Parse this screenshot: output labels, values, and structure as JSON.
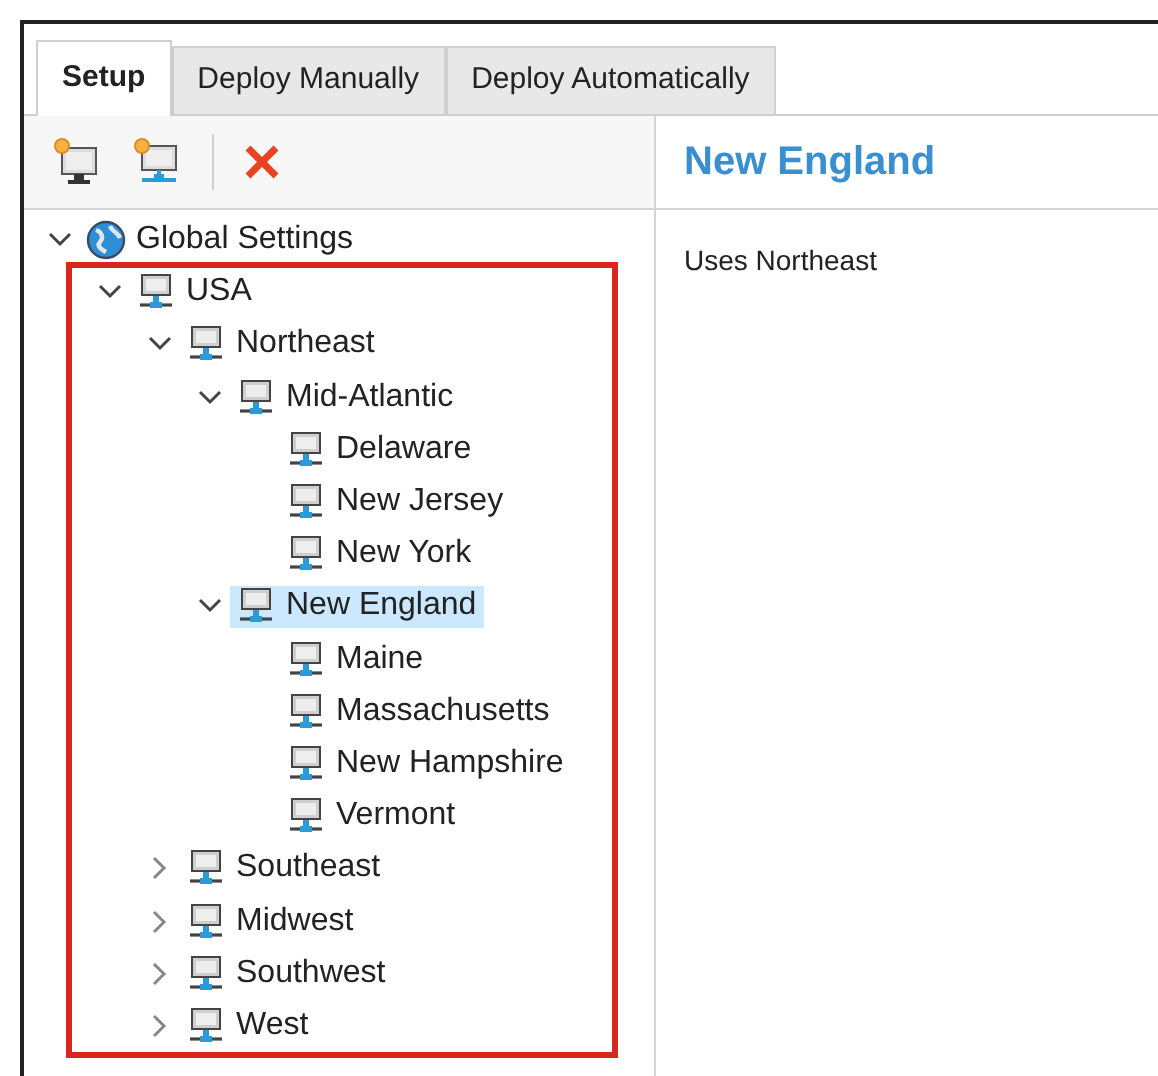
{
  "tabs": [
    {
      "label": "Setup",
      "selected": true
    },
    {
      "label": "Deploy Manually",
      "selected": false
    },
    {
      "label": "Deploy Automatically",
      "selected": false
    }
  ],
  "tree": [
    {
      "label": "Global Settings",
      "kind": "globe",
      "expanded": true,
      "selected": false,
      "children": [
        {
          "label": "USA",
          "kind": "network",
          "expanded": true,
          "selected": false,
          "children": [
            {
              "label": "Northeast",
              "kind": "network",
              "expanded": true,
              "selected": false,
              "children": [
                {
                  "label": "Mid-Atlantic",
                  "kind": "network",
                  "expanded": true,
                  "selected": false,
                  "children": [
                    {
                      "label": "Delaware",
                      "kind": "network",
                      "selected": false
                    },
                    {
                      "label": "New Jersey",
                      "kind": "network",
                      "selected": false
                    },
                    {
                      "label": "New York",
                      "kind": "network",
                      "selected": false
                    }
                  ]
                },
                {
                  "label": "New England",
                  "kind": "network",
                  "expanded": true,
                  "selected": true,
                  "children": [
                    {
                      "label": "Maine",
                      "kind": "network",
                      "selected": false
                    },
                    {
                      "label": "Massachusetts",
                      "kind": "network",
                      "selected": false
                    },
                    {
                      "label": "New Hampshire",
                      "kind": "network",
                      "selected": false
                    },
                    {
                      "label": "Vermont",
                      "kind": "network",
                      "selected": false
                    }
                  ]
                }
              ]
            },
            {
              "label": "Southeast",
              "kind": "network",
              "expanded": false,
              "selected": false
            },
            {
              "label": "Midwest",
              "kind": "network",
              "expanded": false,
              "selected": false
            },
            {
              "label": "Southwest",
              "kind": "network",
              "expanded": false,
              "selected": false
            },
            {
              "label": "West",
              "kind": "network",
              "expanded": false,
              "selected": false
            }
          ]
        }
      ]
    }
  ],
  "details": {
    "title": "New England",
    "text": "Uses Northeast"
  }
}
